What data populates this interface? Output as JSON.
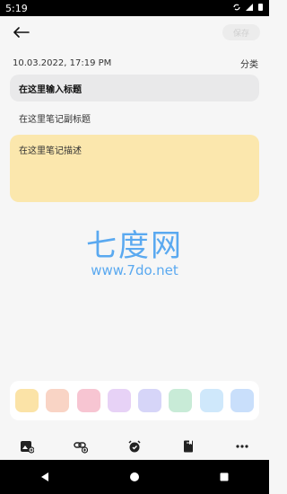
{
  "status": {
    "time": "5:19"
  },
  "header": {
    "save_label": "保存"
  },
  "note": {
    "datetime": "10.03.2022, 17:19 PM",
    "category": "分类",
    "title_placeholder": "在这里输入标题",
    "subtitle_placeholder": "在这里笔记副标题",
    "description_placeholder": "在这里笔记描述"
  },
  "watermark": {
    "main": "七度网",
    "sub": "www.7do.net"
  },
  "colors": {
    "swatches": [
      "#fbe3a7",
      "#f9d4c5",
      "#f7c5d2",
      "#e7d2f6",
      "#d6d5f8",
      "#c8ebd7",
      "#cfe8fb",
      "#c9dffb"
    ],
    "selected_description_color": "#fbe7ad"
  },
  "toolbar": {
    "icons": [
      "add-image-icon",
      "add-link-icon",
      "alarm-icon",
      "book-icon",
      "more-icon"
    ]
  },
  "nav": {
    "icons": [
      "back-triangle-icon",
      "home-circle-icon",
      "recent-square-icon"
    ]
  }
}
